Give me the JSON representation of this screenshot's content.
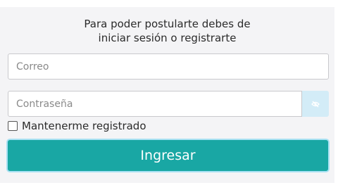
{
  "intro": {
    "line1": "Para poder postularte debes de",
    "line2": "iniciar sesión o registrarte"
  },
  "email": {
    "placeholder": "Correo",
    "value": ""
  },
  "password": {
    "placeholder": "Contraseña",
    "value": "",
    "toggle_icon": "eye-slash-icon"
  },
  "remember": {
    "label": "Mantenerme registrado",
    "checked": false
  },
  "submit": {
    "label": "Ingresar"
  },
  "colors": {
    "accent": "#19a7a4",
    "toggle_bg": "#d3ecf7",
    "panel_bg": "#f4f4f6"
  }
}
